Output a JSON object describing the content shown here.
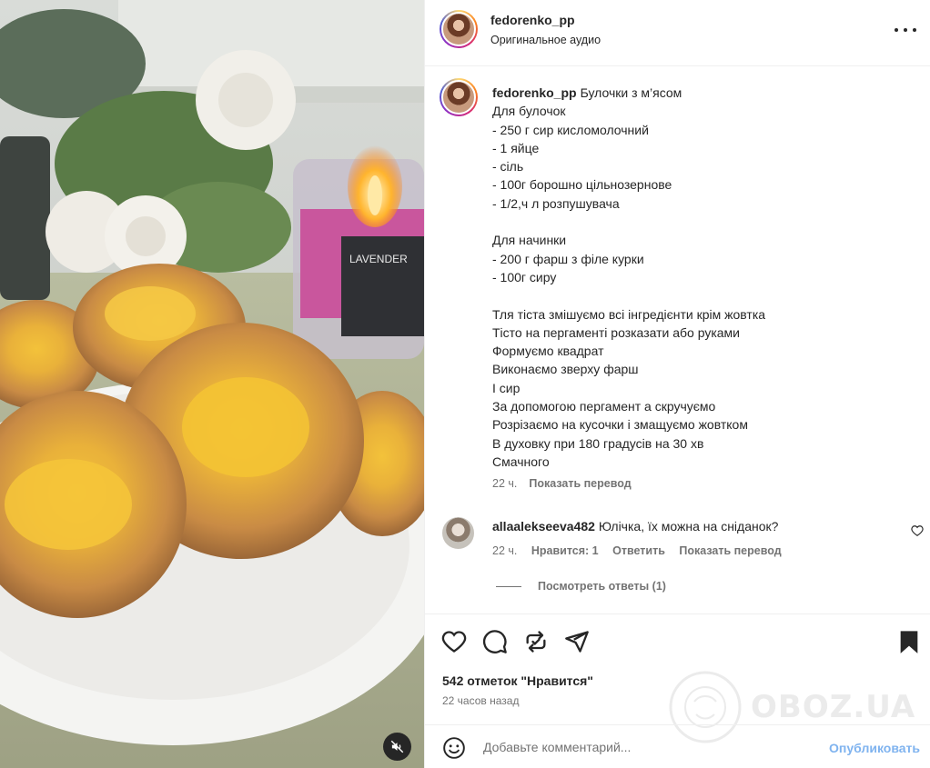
{
  "post": {
    "username": "fedorenko_pp",
    "audio": "Оригинальное аудио"
  },
  "caption": {
    "username": "fedorenko_pp",
    "title": "Булочки з м’ясом",
    "lines": [
      "Для булочок",
      "- 250 г сир кисломолочний",
      "- 1 яйце",
      "- сіль",
      "- 100г борошно цільнозернове",
      "- 1/2,ч л розпушувача",
      "",
      "Для начинки",
      "- 200 г фарш з філе курки",
      "- 100г сиру",
      "",
      "Тля тіста змішуємо всі інгредієнти крім жовтка",
      "Тісто на пергаменті розказати або руками",
      "Формуємо квадрат",
      "Виконаємо зверху фарш",
      "І сир",
      "За допомогою пергамент а скручуємо",
      "Розрізаємо на кусочки і змащуємо жовтком",
      "В духовку при 180 градусів на 30 хв",
      "Смачного"
    ],
    "time": "22 ч.",
    "translate": "Показать перевод"
  },
  "comment": {
    "username": "allaalekseeva482",
    "text": "Юлічка, їх можна на сніданок?",
    "time": "22 ч.",
    "likes": "Нравится: 1",
    "reply": "Ответить",
    "translate": "Показать перевод",
    "view_replies": "Посмотреть ответы (1)"
  },
  "actions": {
    "likes_count": "542 отметок \"Нравится\"",
    "posted": "22 часов назад"
  },
  "add_comment": {
    "placeholder": "Добавьте комментарий...",
    "publish": "Опубликовать"
  },
  "watermark": {
    "text": "OBOZ.UA"
  },
  "icons": {
    "more": "more-horizontal-icon",
    "like": "heart-icon",
    "comment": "comment-bubble-icon",
    "repost": "repost-icon",
    "share": "send-paper-plane-icon",
    "save": "bookmark-icon",
    "emoji": "emoji-smile-icon",
    "mute": "speaker-muted-icon"
  },
  "colors": {
    "text": "#262626",
    "secondary": "#737373",
    "link_blue": "#7fb3ef",
    "border": "#efefef"
  }
}
